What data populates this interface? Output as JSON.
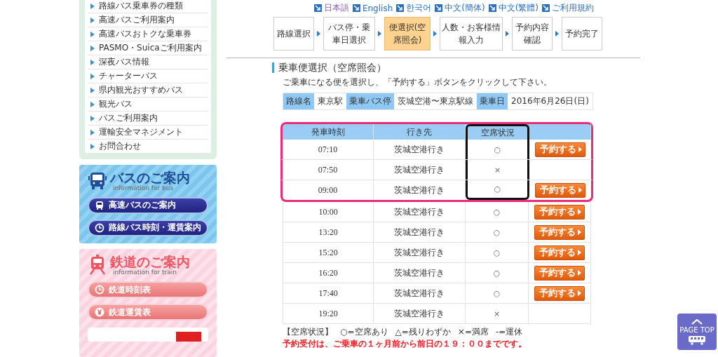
{
  "sidebar": {
    "menu": [
      "路線バス乗車券の種類",
      "高速バスご利用案内",
      "高速バスおトクな乗車券",
      "PASMO・Suicaご利用案内",
      "深夜バス情報",
      "チャーターバス",
      "県内観光おすすめバス",
      "観光バス",
      "バスご利用案内",
      "運輸安全マネジメント",
      "お問合わせ"
    ],
    "bus_panel": {
      "title": "バスのご案内",
      "subtitle": "information for bus",
      "buttons": [
        {
          "label": "高速バスのご案内",
          "kind": "bus"
        },
        {
          "label": "路線バス時刻・運賃案内",
          "kind": "clock"
        }
      ]
    },
    "train_panel": {
      "title": "鉄道のご案内",
      "subtitle": "information for train",
      "buttons": [
        {
          "label": "鉄道時刻表",
          "kind": "clock"
        },
        {
          "label": "鉄道運賃表",
          "kind": "yen"
        }
      ]
    }
  },
  "languages": [
    {
      "label": "日本語",
      "visited": true
    },
    {
      "label": "English",
      "visited": false
    },
    {
      "label": "한국어",
      "visited": false
    },
    {
      "label": "中文(簡体)",
      "visited": false
    },
    {
      "label": "中文(繁體)",
      "visited": false
    },
    {
      "label": "ご利用規約",
      "visited": false
    }
  ],
  "steps": [
    {
      "label": "路線選択",
      "selected": false
    },
    {
      "label": "バス停・乗車日選択",
      "selected": false
    },
    {
      "label": "便選択(空席照会)",
      "selected": true
    },
    {
      "label": "人数・お客様情報入力",
      "selected": false
    },
    {
      "label": "予約内容確認",
      "selected": false
    },
    {
      "label": "予約完了",
      "selected": false
    }
  ],
  "section": {
    "title": "乗車便選択（空席照会）",
    "instruction": "ご乗車になる便を選択し、「予約する」ボタンをクリックして下さい。"
  },
  "trip_info": [
    {
      "label": "路線名",
      "value": "東京駅"
    },
    {
      "label": "乗車バス停",
      "value": "茨城空港〜東京駅線"
    },
    {
      "label": "乗車日",
      "value": "2016年6月26日(日)"
    }
  ],
  "table": {
    "columns": [
      {
        "label": "発車時刻",
        "highlighted": false
      },
      {
        "label": "行き先",
        "highlighted": false
      },
      {
        "label": "空席状況",
        "highlighted": true
      }
    ],
    "rows": [
      {
        "time": "07:10",
        "destination": "茨城空港行き",
        "availability": "○",
        "button": "予約する",
        "highlighted": true
      },
      {
        "time": "07:50",
        "destination": "茨城空港行き",
        "availability": "×",
        "highlighted": true
      },
      {
        "time": "09:00",
        "destination": "茨城空港行き",
        "availability": "○",
        "button": "予約する",
        "highlighted": true
      },
      {
        "time": "10:00",
        "destination": "茨城空港行き",
        "availability": "○",
        "button": "予約する",
        "highlighted": false
      },
      {
        "time": "13:20",
        "destination": "茨城空港行き",
        "availability": "○",
        "button": "予約する",
        "highlighted": false
      },
      {
        "time": "15:20",
        "destination": "茨城空港行き",
        "availability": "○",
        "button": "予約する",
        "highlighted": false
      },
      {
        "time": "16:20",
        "destination": "茨城空港行き",
        "availability": "○",
        "button": "予約する",
        "highlighted": false
      },
      {
        "time": "17:40",
        "destination": "茨城空港行き",
        "availability": "○",
        "button": "予約する",
        "highlighted": false
      },
      {
        "time": "19:20",
        "destination": "茨城空港行き",
        "availability": "×",
        "highlighted": false
      }
    ]
  },
  "legend": {
    "title": "【空席状況】",
    "items": [
      "○=空席あり",
      "△=残りわずか",
      "×=満席",
      "-=運休"
    ]
  },
  "notice": "予約受付は、ご乗車の１ヶ月前から前日の１９：００までです。",
  "page_top": {
    "label": "PAGE TOP"
  }
}
